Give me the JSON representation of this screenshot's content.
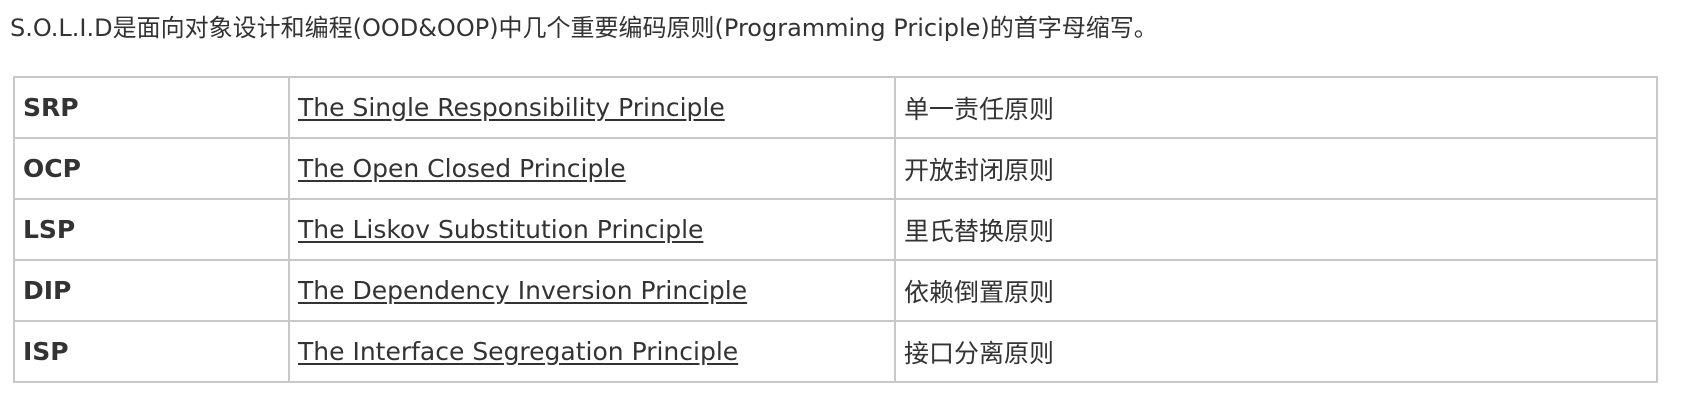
{
  "intro": "S.O.L.I.D是面向对象设计和编程(OOD&OOP)中几个重要编码原则(Programming Priciple)的首字母缩写。",
  "principles": [
    {
      "abbr": "SRP",
      "name": "The Single Responsibility Principle ",
      "cn": "单一责任原则"
    },
    {
      "abbr": "OCP",
      "name": "The Open Closed Principle",
      "cn": "开放封闭原则"
    },
    {
      "abbr": "LSP",
      "name": "The Liskov Substitution Principle",
      "cn": "里氏替换原则"
    },
    {
      "abbr": "DIP",
      "name": "The Dependency Inversion Principle",
      "cn": "依赖倒置原则"
    },
    {
      "abbr": "ISP",
      "name": "The Interface Segregation Principle",
      "cn": "接口分离原则"
    }
  ]
}
